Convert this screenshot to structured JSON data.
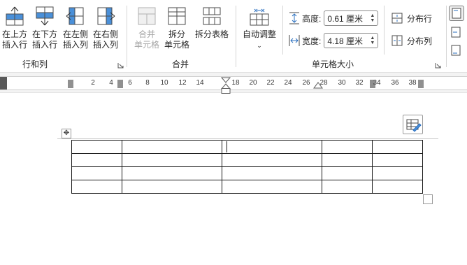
{
  "ribbon": {
    "rows_columns": {
      "label": "行和列",
      "insert_above": [
        "在上方",
        "插入行"
      ],
      "insert_below": [
        "在下方",
        "插入行"
      ],
      "insert_left": [
        "在左侧",
        "插入列"
      ],
      "insert_right": [
        "在右侧",
        "插入列"
      ]
    },
    "merge": {
      "label": "合并",
      "merge_cells": [
        "合并",
        "单元格"
      ],
      "split_cells": [
        "拆分",
        "单元格"
      ],
      "split_table": "拆分表格"
    },
    "cell_size": {
      "label": "单元格大小",
      "autofit": "自动调整",
      "height_label": "高度:",
      "height_value": "0.61 厘米",
      "width_label": "宽度:",
      "width_value": "4.18 厘米",
      "distribute_rows": "分布行",
      "distribute_cols": "分布列"
    }
  },
  "ruler": {
    "ticks": [
      "2",
      "4",
      "6",
      "8",
      "10",
      "12",
      "14",
      "18",
      "20",
      "22",
      "24",
      "26",
      "28",
      "30",
      "32",
      "34",
      "36",
      "38"
    ]
  },
  "table": {
    "rows": 4,
    "columns": 5
  }
}
